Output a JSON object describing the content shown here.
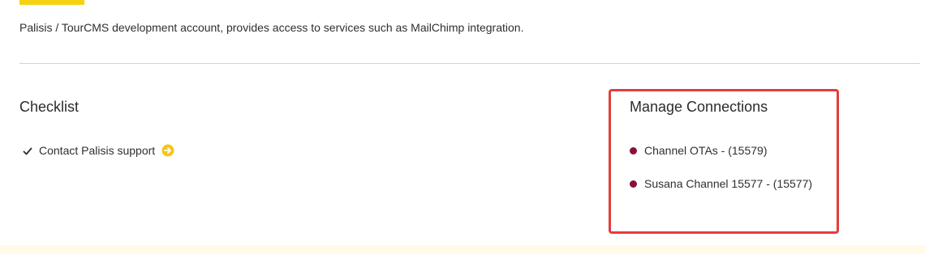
{
  "account": {
    "description": "Palisis / TourCMS development account, provides access to services such as MailChimp integration."
  },
  "checklist": {
    "heading": "Checklist",
    "items": [
      {
        "label": "Contact Palisis support",
        "status": "complete"
      }
    ]
  },
  "connections": {
    "heading": "Manage Connections",
    "items": [
      {
        "label": "Channel OTAs - (15579)"
      },
      {
        "label": "Susana Channel 15577 - (15577)"
      }
    ]
  },
  "icons": {
    "check": "check-icon",
    "arrow": "arrow-circle-right-icon",
    "bullet": "bullet-dot-icon"
  },
  "colors": {
    "accent_yellow": "#f5d313",
    "divider": "#f0dc55",
    "highlight_border": "#e53c3c",
    "bullet": "#8a0f3f",
    "footer_band": "#fffbe6"
  }
}
